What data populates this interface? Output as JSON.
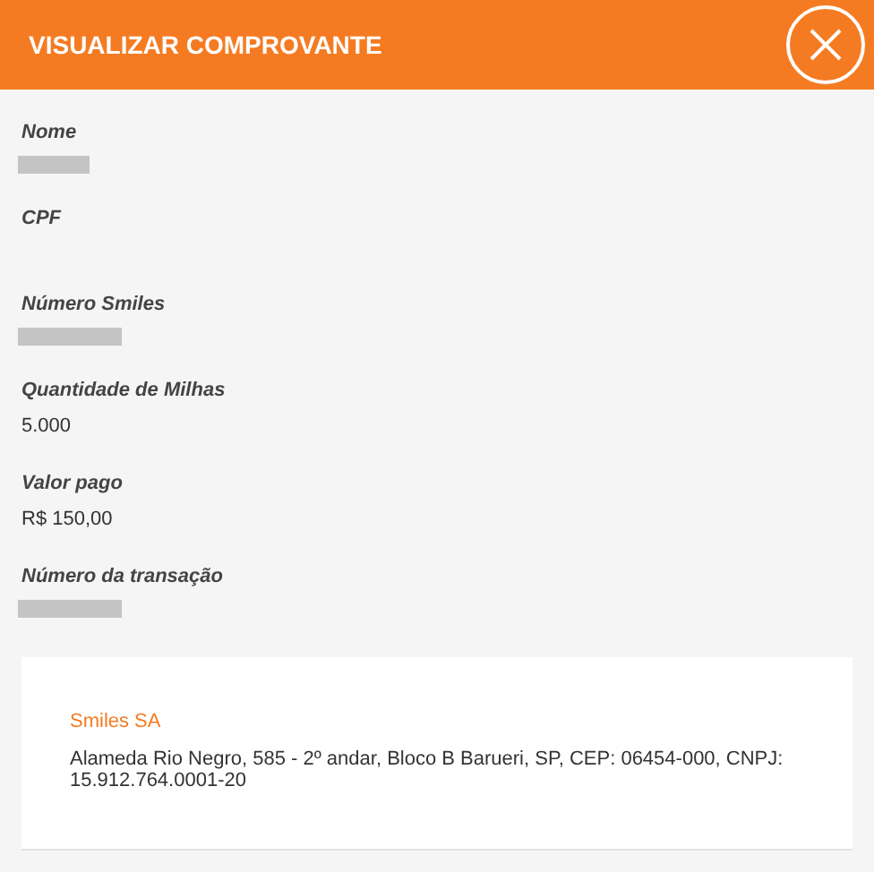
{
  "header": {
    "title": "VISUALIZAR COMPROVANTE"
  },
  "fields": [
    {
      "label": "Nome",
      "kind": "redacted"
    },
    {
      "label": "CPF",
      "kind": "empty"
    },
    {
      "label": "Número Smiles",
      "kind": "redacted"
    },
    {
      "label": "Quantidade de Milhas",
      "kind": "text",
      "value": "5.000"
    },
    {
      "label": "Valor pago",
      "kind": "text",
      "value": "R$ 150,00"
    },
    {
      "label": "Número da transação",
      "kind": "redacted"
    }
  ],
  "company": {
    "name": "Smiles SA",
    "address": "Alameda Rio Negro, 585 - 2º andar, Bloco B Barueri, SP, CEP: 06454-000, CNPJ: 15.912.764.0001-20"
  }
}
